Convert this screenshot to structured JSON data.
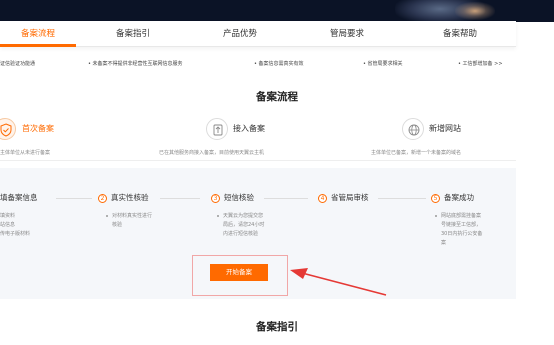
{
  "tabs": [
    {
      "label": "备案流程",
      "active": true
    },
    {
      "label": "备案指引",
      "active": false
    },
    {
      "label": "产品优势",
      "active": false
    },
    {
      "label": "管局要求",
      "active": false
    },
    {
      "label": "备案帮助",
      "active": false
    }
  ],
  "notices": [
    "证信验证功能通",
    "• 未备案不得提供非经营性互联网信息服务",
    "• 备案信息需真实有效",
    "• 省管局要求相关",
    "• 工信部增加备 >>"
  ],
  "process": {
    "title": "备案流程",
    "steps": [
      {
        "label": "首次备案",
        "desc": "主体单位从未进行备案",
        "icon": "shield-icon",
        "active": true
      },
      {
        "label": "接入备案",
        "desc": "已在其他服务商接入备案，目前使用天翼云主机",
        "icon": "transfer-icon",
        "active": false
      },
      {
        "label": "新增网站",
        "desc": "主体单位已备案，新增一个未备案的域名",
        "icon": "globe-icon",
        "active": false
      }
    ]
  },
  "flow": {
    "items": [
      {
        "num": "",
        "title": "填备案信息",
        "lines": [
          "填资料",
          "站信息",
          "传电子版材料"
        ]
      },
      {
        "num": "2",
        "title": "真实性核验",
        "lines": [
          "对材料真实性进行",
          "核验"
        ]
      },
      {
        "num": "3",
        "title": "短信核验",
        "lines": [
          "天翼云为您提交您",
          "局后，请您24小时",
          "内进行短信核验"
        ]
      },
      {
        "num": "4",
        "title": "省管局审核",
        "lines": []
      },
      {
        "num": "5",
        "title": "备案成功",
        "lines": [
          "网站底部需挂备案",
          "号链接至工信部，",
          "30日内执行公安备",
          "案"
        ]
      }
    ],
    "start_button": "开始备案"
  },
  "guide": {
    "title": "备案指引"
  },
  "colors": {
    "accent": "#ff6a00",
    "panel": "#f5f7fa",
    "arrow": "#e53935"
  }
}
